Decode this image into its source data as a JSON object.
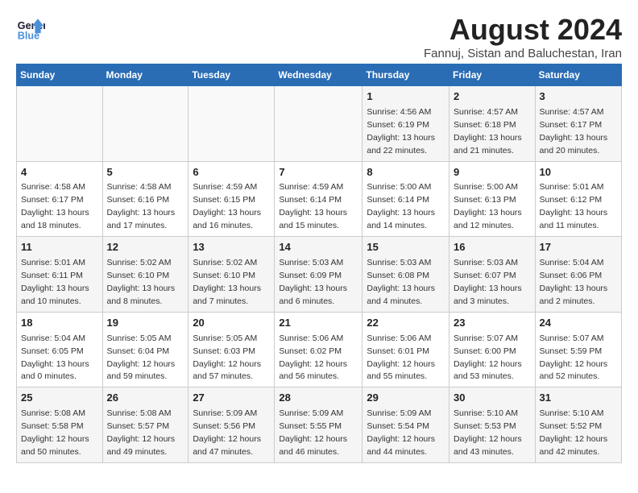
{
  "logo": {
    "line1": "General",
    "line2": "Blue"
  },
  "title": "August 2024",
  "subtitle": "Fannuj, Sistan and Baluchestan, Iran",
  "weekdays": [
    "Sunday",
    "Monday",
    "Tuesday",
    "Wednesday",
    "Thursday",
    "Friday",
    "Saturday"
  ],
  "weeks": [
    [
      {
        "day": "",
        "info": ""
      },
      {
        "day": "",
        "info": ""
      },
      {
        "day": "",
        "info": ""
      },
      {
        "day": "",
        "info": ""
      },
      {
        "day": "1",
        "info": "Sunrise: 4:56 AM\nSunset: 6:19 PM\nDaylight: 13 hours\nand 22 minutes."
      },
      {
        "day": "2",
        "info": "Sunrise: 4:57 AM\nSunset: 6:18 PM\nDaylight: 13 hours\nand 21 minutes."
      },
      {
        "day": "3",
        "info": "Sunrise: 4:57 AM\nSunset: 6:17 PM\nDaylight: 13 hours\nand 20 minutes."
      }
    ],
    [
      {
        "day": "4",
        "info": "Sunrise: 4:58 AM\nSunset: 6:17 PM\nDaylight: 13 hours\nand 18 minutes."
      },
      {
        "day": "5",
        "info": "Sunrise: 4:58 AM\nSunset: 6:16 PM\nDaylight: 13 hours\nand 17 minutes."
      },
      {
        "day": "6",
        "info": "Sunrise: 4:59 AM\nSunset: 6:15 PM\nDaylight: 13 hours\nand 16 minutes."
      },
      {
        "day": "7",
        "info": "Sunrise: 4:59 AM\nSunset: 6:14 PM\nDaylight: 13 hours\nand 15 minutes."
      },
      {
        "day": "8",
        "info": "Sunrise: 5:00 AM\nSunset: 6:14 PM\nDaylight: 13 hours\nand 14 minutes."
      },
      {
        "day": "9",
        "info": "Sunrise: 5:00 AM\nSunset: 6:13 PM\nDaylight: 13 hours\nand 12 minutes."
      },
      {
        "day": "10",
        "info": "Sunrise: 5:01 AM\nSunset: 6:12 PM\nDaylight: 13 hours\nand 11 minutes."
      }
    ],
    [
      {
        "day": "11",
        "info": "Sunrise: 5:01 AM\nSunset: 6:11 PM\nDaylight: 13 hours\nand 10 minutes."
      },
      {
        "day": "12",
        "info": "Sunrise: 5:02 AM\nSunset: 6:10 PM\nDaylight: 13 hours\nand 8 minutes."
      },
      {
        "day": "13",
        "info": "Sunrise: 5:02 AM\nSunset: 6:10 PM\nDaylight: 13 hours\nand 7 minutes."
      },
      {
        "day": "14",
        "info": "Sunrise: 5:03 AM\nSunset: 6:09 PM\nDaylight: 13 hours\nand 6 minutes."
      },
      {
        "day": "15",
        "info": "Sunrise: 5:03 AM\nSunset: 6:08 PM\nDaylight: 13 hours\nand 4 minutes."
      },
      {
        "day": "16",
        "info": "Sunrise: 5:03 AM\nSunset: 6:07 PM\nDaylight: 13 hours\nand 3 minutes."
      },
      {
        "day": "17",
        "info": "Sunrise: 5:04 AM\nSunset: 6:06 PM\nDaylight: 13 hours\nand 2 minutes."
      }
    ],
    [
      {
        "day": "18",
        "info": "Sunrise: 5:04 AM\nSunset: 6:05 PM\nDaylight: 13 hours\nand 0 minutes."
      },
      {
        "day": "19",
        "info": "Sunrise: 5:05 AM\nSunset: 6:04 PM\nDaylight: 12 hours\nand 59 minutes."
      },
      {
        "day": "20",
        "info": "Sunrise: 5:05 AM\nSunset: 6:03 PM\nDaylight: 12 hours\nand 57 minutes."
      },
      {
        "day": "21",
        "info": "Sunrise: 5:06 AM\nSunset: 6:02 PM\nDaylight: 12 hours\nand 56 minutes."
      },
      {
        "day": "22",
        "info": "Sunrise: 5:06 AM\nSunset: 6:01 PM\nDaylight: 12 hours\nand 55 minutes."
      },
      {
        "day": "23",
        "info": "Sunrise: 5:07 AM\nSunset: 6:00 PM\nDaylight: 12 hours\nand 53 minutes."
      },
      {
        "day": "24",
        "info": "Sunrise: 5:07 AM\nSunset: 5:59 PM\nDaylight: 12 hours\nand 52 minutes."
      }
    ],
    [
      {
        "day": "25",
        "info": "Sunrise: 5:08 AM\nSunset: 5:58 PM\nDaylight: 12 hours\nand 50 minutes."
      },
      {
        "day": "26",
        "info": "Sunrise: 5:08 AM\nSunset: 5:57 PM\nDaylight: 12 hours\nand 49 minutes."
      },
      {
        "day": "27",
        "info": "Sunrise: 5:09 AM\nSunset: 5:56 PM\nDaylight: 12 hours\nand 47 minutes."
      },
      {
        "day": "28",
        "info": "Sunrise: 5:09 AM\nSunset: 5:55 PM\nDaylight: 12 hours\nand 46 minutes."
      },
      {
        "day": "29",
        "info": "Sunrise: 5:09 AM\nSunset: 5:54 PM\nDaylight: 12 hours\nand 44 minutes."
      },
      {
        "day": "30",
        "info": "Sunrise: 5:10 AM\nSunset: 5:53 PM\nDaylight: 12 hours\nand 43 minutes."
      },
      {
        "day": "31",
        "info": "Sunrise: 5:10 AM\nSunset: 5:52 PM\nDaylight: 12 hours\nand 42 minutes."
      }
    ]
  ]
}
